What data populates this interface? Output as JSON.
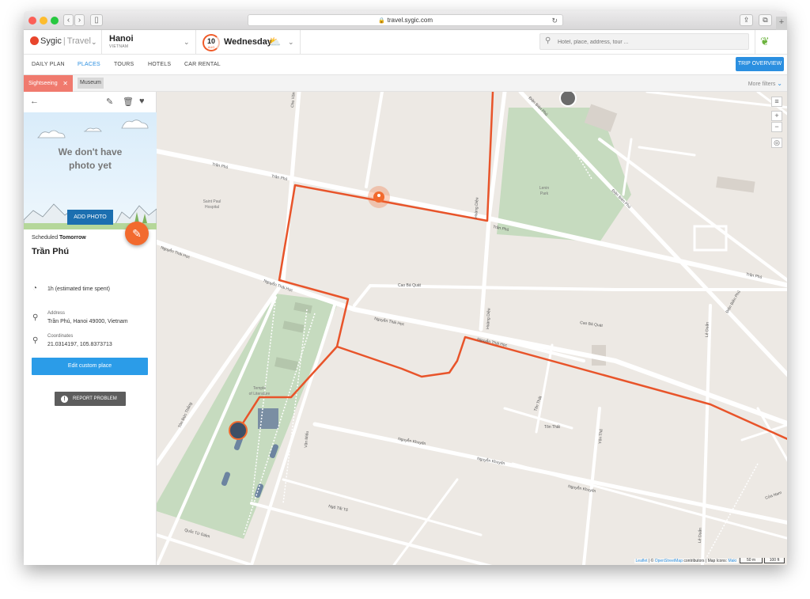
{
  "browser": {
    "url": "travel.sygic.com"
  },
  "header": {
    "logo_brand": "Sygic",
    "logo_product": "Travel",
    "city": "Hanoi",
    "country": "VIETNAM",
    "date_day": "10",
    "date_month": "AUG",
    "weekday": "Wednesday",
    "search_placeholder": "Hotel, place, address, tour ..."
  },
  "tabs": [
    {
      "label": "DAILY PLAN"
    },
    {
      "label": "PLACES"
    },
    {
      "label": "TOURS"
    },
    {
      "label": "HOTELS"
    },
    {
      "label": "CAR RENTAL"
    }
  ],
  "trip_overview": "TRIP OVERVIEW",
  "filters": {
    "active": "Sightseeing",
    "chip": "Museum",
    "more": "More filters"
  },
  "sidebar": {
    "no_photo": "We don't have photo yet",
    "add_photo": "ADD PHOTO",
    "scheduled_prefix": "Scheduled",
    "scheduled_day": "Tomorrow",
    "title": "Trần Phú",
    "time_spent": "1h (estimated time spent)",
    "address_label": "Address",
    "address": "Trần Phú, Hanoi 49000, Vietnam",
    "coords_label": "Coordinates",
    "coords": "21.0314197, 105.8373713",
    "edit_button": "Edit custom place",
    "report_button": "REPORT PROBLEM"
  },
  "map": {
    "streets": {
      "tran_phu_1": "Trần Phú",
      "tran_phu_2": "Trần Phú",
      "tran_phu_3": "Trần Phú",
      "tran_phu_4": "Trần Phú",
      "nguyen_thai_hoc_1": "Nguyễn Thái Học",
      "nguyen_thai_hoc_2": "Nguyễn Thái Học",
      "nguyen_thai_hoc_3": "Nguyễn Thái Học",
      "nguyen_thai_hoc_4": "Nguyễn Thái Học",
      "cao_ba_quat_1": "Cao Bá Quát",
      "cao_ba_quat_2": "Cao Bá Quát",
      "nguyen_khuyen_1": "Nguyễn Khuyến",
      "nguyen_khuyen_2": "Nguyễn Khuyến",
      "nguyen_khuyen_3": "Nguyễn Khuyến",
      "ton_that_1": "Tôn Thất",
      "ton_that_2": "Tôn Thất",
      "yen_thai": "Yên Thế",
      "hoang_dieu_1": "Hoàng Diệu",
      "hoang_dieu_2": "Hoàng Diệu",
      "dien_bien_phu_1": "Điện Biên Phủ",
      "dien_bien_phu_2": "Điện Biên Phủ",
      "dien_bien_phu_3": "Điện Biên Phủ",
      "le_duan_1": "Lê Duẩn",
      "le_duan_2": "Lê Duẩn",
      "van_mieu": "Văn Miếu",
      "quoc_tu_giam": "Quốc Tử Giám",
      "ton_duc_thang": "Tôn Đức Thắng",
      "ngo_tat_to": "Ngô Tất Tố",
      "chu_van_an": "Chu Văn An",
      "cua_nam": "Cửa Nam"
    },
    "pois": {
      "saint_paul_1": "Saint Paul",
      "saint_paul_2": "Hospital",
      "lenin_park_1": "Lenin",
      "lenin_park_2": "Park",
      "temple_1": "Temple",
      "temple_2": "of Literature"
    },
    "attribution": {
      "leaflet": "Leaflet",
      "sep": " | © ",
      "osm": "OpenStreetMap",
      "mid": " contributors | Map Icons: ",
      "maki": "Maki"
    },
    "scale_m": "50 m",
    "scale_ft": "100 ft"
  },
  "colors": {
    "accent_blue": "#2b8fe0",
    "route_orange": "#e8542a",
    "fab_orange": "#f26a2e",
    "chip_active": "#f07a6e",
    "park_green": "#c6dbbf"
  },
  "icons": {
    "back": "arrow-left-icon",
    "edit_note": "edit-note-icon",
    "delete": "trash-icon",
    "favorite": "heart-icon",
    "time": "clock-icon",
    "location": "map-pin-icon",
    "pencil": "pencil-icon",
    "warning": "alert-icon"
  }
}
